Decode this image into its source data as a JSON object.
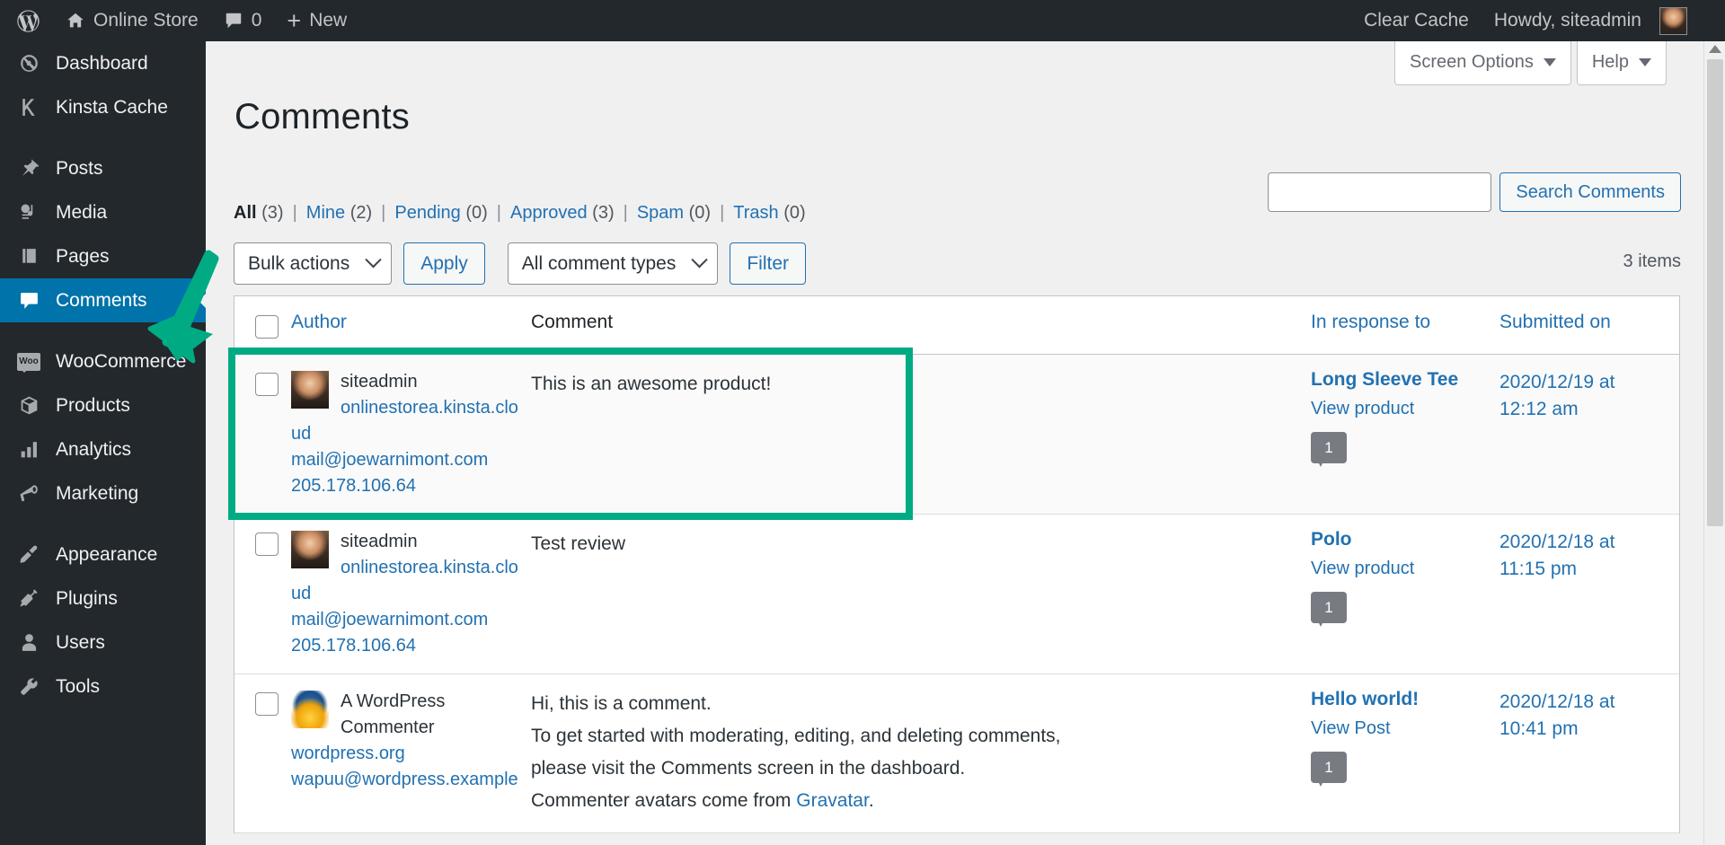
{
  "adminbar": {
    "wp_logo": "wordpress-logo-icon",
    "site_name": "Online Store",
    "comments_count": "0",
    "new_label": "New",
    "clear_cache": "Clear Cache",
    "howdy": "Howdy, siteadmin"
  },
  "sidebar": {
    "items": [
      {
        "label": "Dashboard",
        "icon": "dashboard-icon",
        "active": false
      },
      {
        "label": "Kinsta Cache",
        "icon": "kinsta-k-icon",
        "active": false
      },
      {
        "label": "Posts",
        "icon": "pin-icon",
        "active": false
      },
      {
        "label": "Media",
        "icon": "media-icon",
        "active": false
      },
      {
        "label": "Pages",
        "icon": "pages-icon",
        "active": false
      },
      {
        "label": "Comments",
        "icon": "comment-bubble-icon",
        "active": true
      },
      {
        "label": "WooCommerce",
        "icon": "woo-icon",
        "active": false
      },
      {
        "label": "Products",
        "icon": "box-icon",
        "active": false
      },
      {
        "label": "Analytics",
        "icon": "bar-chart-icon",
        "active": false
      },
      {
        "label": "Marketing",
        "icon": "megaphone-icon",
        "active": false
      },
      {
        "label": "Appearance",
        "icon": "paintbrush-icon",
        "active": false
      },
      {
        "label": "Plugins",
        "icon": "plug-icon",
        "active": false
      },
      {
        "label": "Users",
        "icon": "user-icon",
        "active": false
      },
      {
        "label": "Tools",
        "icon": "wrench-icon",
        "active": false
      }
    ]
  },
  "screen_meta": {
    "screen_options": "Screen Options",
    "help": "Help"
  },
  "page": {
    "title": "Comments",
    "items_count": "3 items"
  },
  "filters": [
    {
      "label": "All",
      "count": "(3)",
      "current": true
    },
    {
      "label": "Mine",
      "count": "(2)",
      "current": false
    },
    {
      "label": "Pending",
      "count": "(0)",
      "current": false
    },
    {
      "label": "Approved",
      "count": "(3)",
      "current": false
    },
    {
      "label": "Spam",
      "count": "(0)",
      "current": false
    },
    {
      "label": "Trash",
      "count": "(0)",
      "current": false
    }
  ],
  "search": {
    "value": "",
    "placeholder": "",
    "button_label": "Search Comments"
  },
  "tablenav": {
    "bulk_actions_label": "Bulk actions",
    "apply_label": "Apply",
    "comment_types_label": "All comment types",
    "filter_label": "Filter"
  },
  "table": {
    "headers": {
      "author": "Author",
      "comment": "Comment",
      "response": "In response to",
      "submitted": "Submitted on"
    },
    "rows": [
      {
        "author_name": "siteadmin",
        "author_site": "onlinestorea.kinsta.cloud",
        "author_email": "mail@joewarnimont.com",
        "author_ip": "205.178.106.64",
        "avatar": "siteadmin-avatar",
        "comment_lines": [
          "This is an awesome product!"
        ],
        "response_title": "Long Sleeve Tee",
        "response_view": "View product",
        "response_count": "1",
        "date_line1": "2020/12/19 at",
        "date_line2": "12:12 am",
        "highlighted": true
      },
      {
        "author_name": "siteadmin",
        "author_site": "onlinestorea.kinsta.cloud",
        "author_email": "mail@joewarnimont.com",
        "author_ip": "205.178.106.64",
        "avatar": "siteadmin-avatar",
        "comment_lines": [
          "Test review"
        ],
        "response_title": "Polo",
        "response_view": "View product",
        "response_count": "1",
        "date_line1": "2020/12/18 at",
        "date_line2": "11:15 pm",
        "highlighted": false
      },
      {
        "author_name": "A WordPress Commenter",
        "author_site": "wordpress.org",
        "author_email": "wapuu@wordpress.example",
        "author_ip": "",
        "avatar": "wapuu-avatar",
        "comment_lines": [
          "Hi, this is a comment.",
          "To get started with moderating, editing, and deleting comments,",
          "please visit the Comments screen in the dashboard.",
          "Commenter avatars come from Gravatar."
        ],
        "comment_link_text": "Gravatar",
        "response_title": "Hello world!",
        "response_view": "View Post",
        "response_count": "1",
        "date_line1": "2020/12/18 at",
        "date_line2": "10:41 pm",
        "highlighted": false
      }
    ]
  },
  "annotation": {
    "arrow_color": "#00ab84",
    "highlight_color": "#00ab84"
  },
  "colors": {
    "sidebar_bg": "#23282d",
    "active_blue": "#0073aa",
    "link_blue": "#2271b1",
    "content_bg": "#f0f0f1"
  }
}
